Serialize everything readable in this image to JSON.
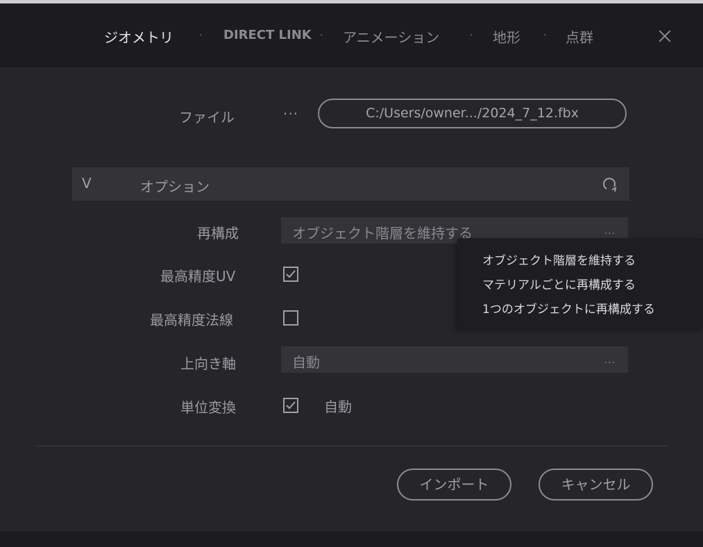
{
  "tabs": [
    {
      "label": "ジオメトリ",
      "active": true
    },
    {
      "label": "DIRECT LINK",
      "active": false
    },
    {
      "label": "アニメーション",
      "active": false
    },
    {
      "label": "地形",
      "active": false
    },
    {
      "label": "点群",
      "active": false
    }
  ],
  "tab_separator": "·",
  "file": {
    "label": "ファイル",
    "browse_label": "···",
    "path": "C:/Users/owner.../2024_7_12.fbx"
  },
  "options": {
    "title": "オプション",
    "chevron": "V",
    "reset_icon": "reset-icon"
  },
  "rebuild": {
    "label": "再構成",
    "value": "オブジェクト階層を維持する",
    "more": "..."
  },
  "highest_uv": {
    "label": "最高精度UV",
    "checked": true
  },
  "highest_normal": {
    "label": "最高精度法線",
    "checked": false
  },
  "up_axis": {
    "label": "上向き軸",
    "value": "自動",
    "more": "..."
  },
  "unit_conversion": {
    "label": "単位変換",
    "checked": true,
    "text": "自動"
  },
  "buttons": {
    "import": "インポート",
    "cancel": "キャンセル"
  },
  "dropdown": {
    "options": [
      "オブジェクト階層を維持する",
      "マテリアルごとに再構成する",
      "1つのオブジェクトに再構成する"
    ]
  },
  "colors": {
    "background": "#25252a",
    "header": "#1c1c20",
    "field": "#333338",
    "menu": "#1e1e22"
  }
}
